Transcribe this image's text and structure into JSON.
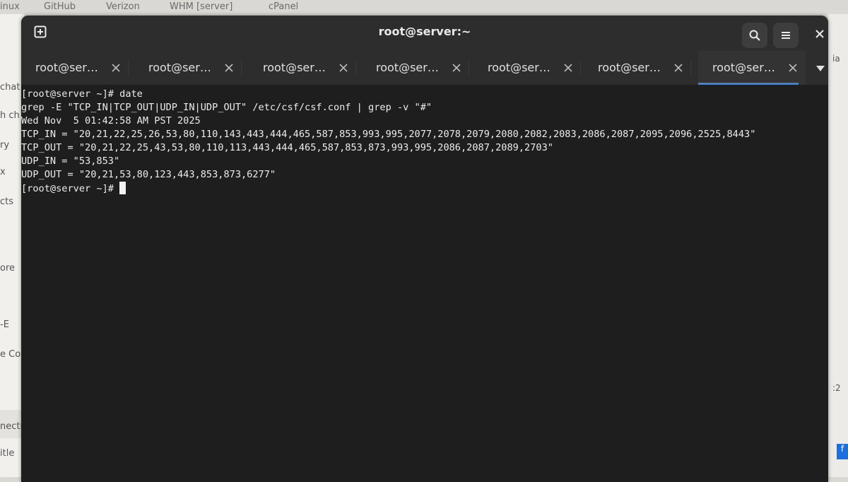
{
  "window": {
    "title": "root@server:~"
  },
  "background": {
    "bookmarks": [
      "inux",
      "GitHub",
      "Verizon",
      "WHM [server]",
      "cPanel"
    ],
    "left_fragments": [
      "chat",
      "h ch",
      "ry",
      "x",
      "cts",
      "ore",
      "-E",
      "e Cop",
      "necti",
      "itle"
    ],
    "right_fragments": [
      "ia",
      ":2"
    ]
  },
  "tabs": [
    {
      "label": "root@ser…",
      "active": false
    },
    {
      "label": "root@ser…",
      "active": false
    },
    {
      "label": "root@ser…",
      "active": false
    },
    {
      "label": "root@ser…",
      "active": false
    },
    {
      "label": "root@ser…",
      "active": false
    },
    {
      "label": "root@ser…",
      "active": false
    },
    {
      "label": "root@ser…",
      "active": true
    }
  ],
  "terminal": {
    "lines": [
      "[root@server ~]# date",
      "grep -E \"TCP_IN|TCP_OUT|UDP_IN|UDP_OUT\" /etc/csf/csf.conf | grep -v \"#\"",
      "Wed Nov  5 01:42:58 AM PST 2025",
      "TCP_IN = \"20,21,22,25,26,53,80,110,143,443,444,465,587,853,993,995,2077,2078,2079,2080,2082,2083,2086,2087,2095,2096,2525,8443\"",
      "TCP_OUT = \"20,21,22,25,43,53,80,110,113,443,444,465,587,853,873,993,995,2086,2087,2089,2703\"",
      "UDP_IN = \"53,853\"",
      "UDP_OUT = \"20,21,53,80,123,443,853,873,6277\""
    ],
    "prompt": "[root@server ~]# "
  },
  "colors": {
    "terminal_bg": "#1e1e1e",
    "titlebar_bg": "#2d2d2d",
    "accent": "#3584e4",
    "text": "#ececec"
  }
}
